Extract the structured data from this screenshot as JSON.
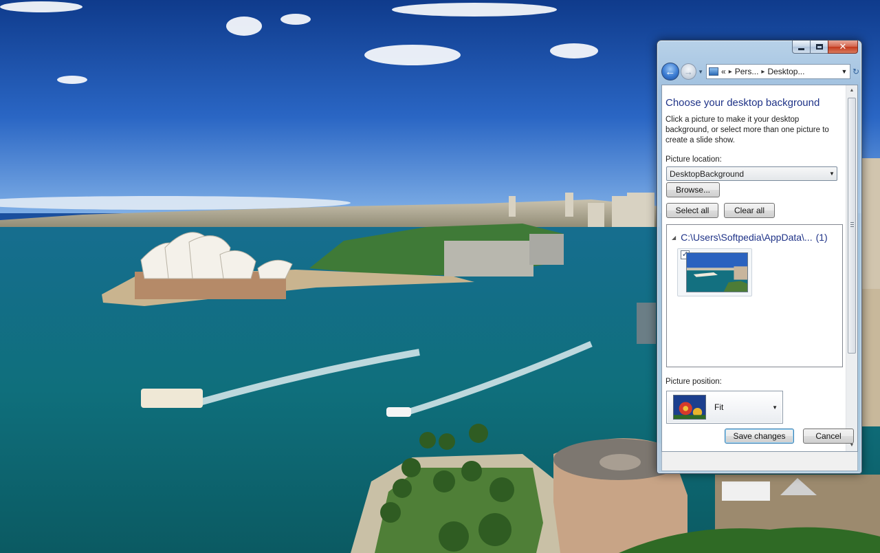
{
  "window": {
    "address": {
      "overflow": "«",
      "crumb1": "Pers...",
      "crumb2": "Desktop..."
    },
    "title": "Choose your desktop background",
    "description": "Click a picture to make it your desktop background, or select more than one picture to create a slide show.",
    "picture_location_label": "Picture location:",
    "picture_location_value": "DesktopBackground",
    "browse_label": "Browse...",
    "select_all_label": "Select all",
    "clear_all_label": "Clear all",
    "group_header": "C:\\Users\\Softpedia\\AppData\\...",
    "group_count": "(1)",
    "picture_position_label": "Picture position:",
    "picture_position_value": "Fit",
    "save_label": "Save changes",
    "cancel_label": "Cancel"
  },
  "icons": [
    "minimize-icon",
    "maximize-icon",
    "close-icon",
    "back-icon",
    "forward-icon",
    "refresh-icon",
    "checkbox-icon",
    "dropdown-arrow-icon"
  ],
  "colors": {
    "title_blue": "#1e3287",
    "sky": "#1a4f9e",
    "sea": "#0f6a7d"
  }
}
